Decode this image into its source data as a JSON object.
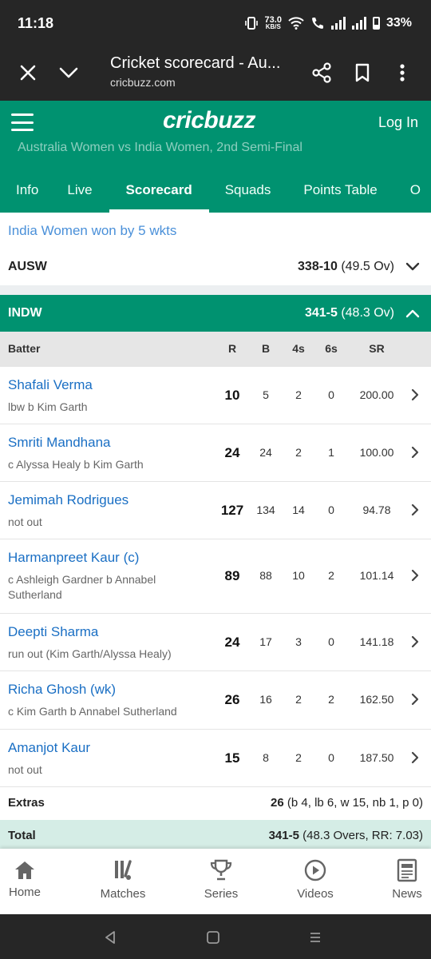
{
  "status_bar": {
    "time": "11:18",
    "net_speed_value": "73.0",
    "net_speed_unit": "KB/S",
    "battery": "33%"
  },
  "browser": {
    "title": "Cricket scorecard - Au...",
    "url": "cricbuzz.com"
  },
  "header": {
    "logo": "cricbuzz",
    "login": "Log In",
    "match_subtitle": "Australia Women vs India Women, 2nd Semi-Final",
    "tabs": [
      {
        "label": "Info"
      },
      {
        "label": "Live"
      },
      {
        "label": "Scorecard",
        "active": true
      },
      {
        "label": "Squads"
      },
      {
        "label": "Points Table"
      },
      {
        "label": "O"
      }
    ]
  },
  "result": "India Women won by 5 wkts",
  "innings": [
    {
      "team": "AUSW",
      "score": "338-10",
      "overs": "(49.5 Ov)",
      "expanded": false
    },
    {
      "team": "INDW",
      "score": "341-5",
      "overs": "(48.3 Ov)",
      "expanded": true
    }
  ],
  "batting_headers": {
    "batter": "Batter",
    "r": "R",
    "b": "B",
    "fours": "4s",
    "sixes": "6s",
    "sr": "SR"
  },
  "batters": [
    {
      "name": "Shafali Verma",
      "dismissal": "lbw b Kim Garth",
      "r": "10",
      "b": "5",
      "fours": "2",
      "sixes": "0",
      "sr": "200.00"
    },
    {
      "name": "Smriti Mandhana",
      "dismissal": "c Alyssa Healy b Kim Garth",
      "r": "24",
      "b": "24",
      "fours": "2",
      "sixes": "1",
      "sr": "100.00"
    },
    {
      "name": "Jemimah Rodrigues",
      "dismissal": "not out",
      "r": "127",
      "b": "134",
      "fours": "14",
      "sixes": "0",
      "sr": "94.78"
    },
    {
      "name": "Harmanpreet Kaur (c)",
      "dismissal": "c Ashleigh Gardner b Annabel Sutherland",
      "r": "89",
      "b": "88",
      "fours": "10",
      "sixes": "2",
      "sr": "101.14"
    },
    {
      "name": "Deepti Sharma",
      "dismissal": "run out (Kim Garth/Alyssa Healy)",
      "r": "24",
      "b": "17",
      "fours": "3",
      "sixes": "0",
      "sr": "141.18"
    },
    {
      "name": "Richa Ghosh (wk)",
      "dismissal": "c Kim Garth b Annabel Sutherland",
      "r": "26",
      "b": "16",
      "fours": "2",
      "sixes": "2",
      "sr": "162.50"
    },
    {
      "name": "Amanjot Kaur",
      "dismissal": "not out",
      "r": "15",
      "b": "8",
      "fours": "2",
      "sixes": "0",
      "sr": "187.50"
    }
  ],
  "extras": {
    "label": "Extras",
    "total": "26",
    "detail": "(b 4, lb 6, w 15, nb 1, p 0)"
  },
  "total": {
    "label": "Total",
    "score": "341-5",
    "detail": "(48.3 Overs, RR: 7.03)"
  },
  "bottom_nav": [
    {
      "label": "Home",
      "icon": "home-icon"
    },
    {
      "label": "Matches",
      "icon": "cricket-bat-icon"
    },
    {
      "label": "Series",
      "icon": "trophy-icon"
    },
    {
      "label": "Videos",
      "icon": "play-circle-icon"
    },
    {
      "label": "News",
      "icon": "newspaper-icon"
    }
  ],
  "colors": {
    "brand_green": "#009270",
    "link_blue": "#1a6fc4",
    "total_bg": "#d5ede6"
  }
}
